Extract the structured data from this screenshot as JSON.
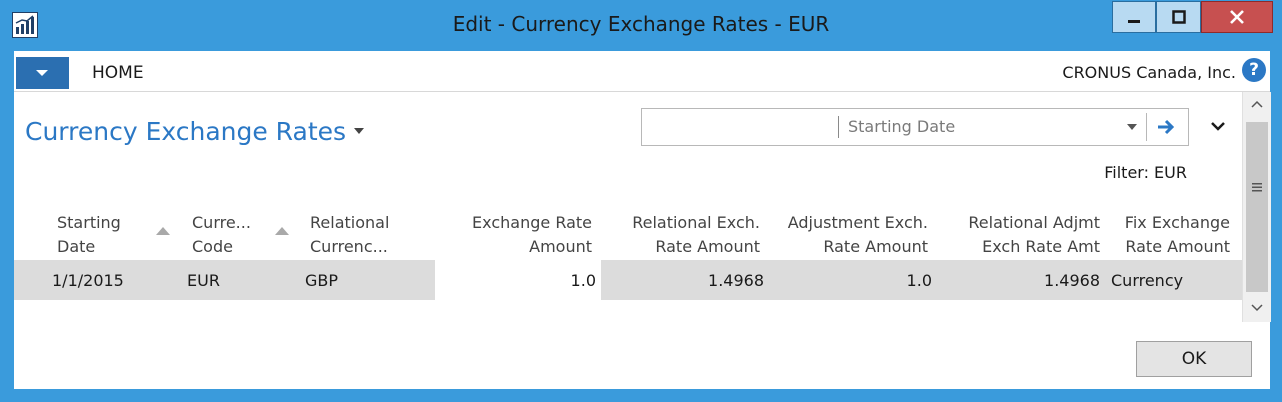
{
  "window": {
    "title": "Edit - Currency Exchange Rates - EUR",
    "controls": [
      "minimize-icon",
      "maximize-icon",
      "close-icon"
    ]
  },
  "ribbon": {
    "home_tab": "HOME",
    "company": "CRONUS Canada, Inc.",
    "help": "?"
  },
  "page": {
    "title": "Currency Exchange Rates",
    "filter_text": "Filter: EUR"
  },
  "search": {
    "value": "",
    "field": "Starting Date"
  },
  "table": {
    "headers": {
      "starting_date": [
        "Starting",
        "Date"
      ],
      "currency_code": [
        "Curre...",
        "Code"
      ],
      "relational_currency": [
        "Relational",
        "Currenc..."
      ],
      "exchange_rate_amount": [
        "Exchange Rate",
        "Amount"
      ],
      "relational_exch_rate_amount": [
        "Relational Exch.",
        "Rate Amount"
      ],
      "adjustment_exch_rate_amount": [
        "Adjustment Exch.",
        "Rate Amount"
      ],
      "relational_adjmt_exch_rate_amt": [
        "Relational Adjmt",
        "Exch Rate Amt"
      ],
      "fix_exchange_rate_amount": [
        "Fix Exchange",
        "Rate Amount"
      ]
    },
    "rows": [
      {
        "starting_date": "1/1/2015",
        "currency_code": "EUR",
        "relational_currency": "GBP",
        "exchange_rate_amount": "1.0",
        "relational_exch_rate_amount": "1.4968",
        "adjustment_exch_rate_amount": "1.0",
        "relational_adjmt_exch_rate_amt": "1.4968",
        "fix_exchange_rate_amount": "Currency"
      }
    ]
  },
  "buttons": {
    "ok": "OK"
  },
  "colors": {
    "frame": "#3a9bdc",
    "accent": "#2b78c5",
    "close": "#c75050",
    "row_selected": "#dcdcdc"
  }
}
